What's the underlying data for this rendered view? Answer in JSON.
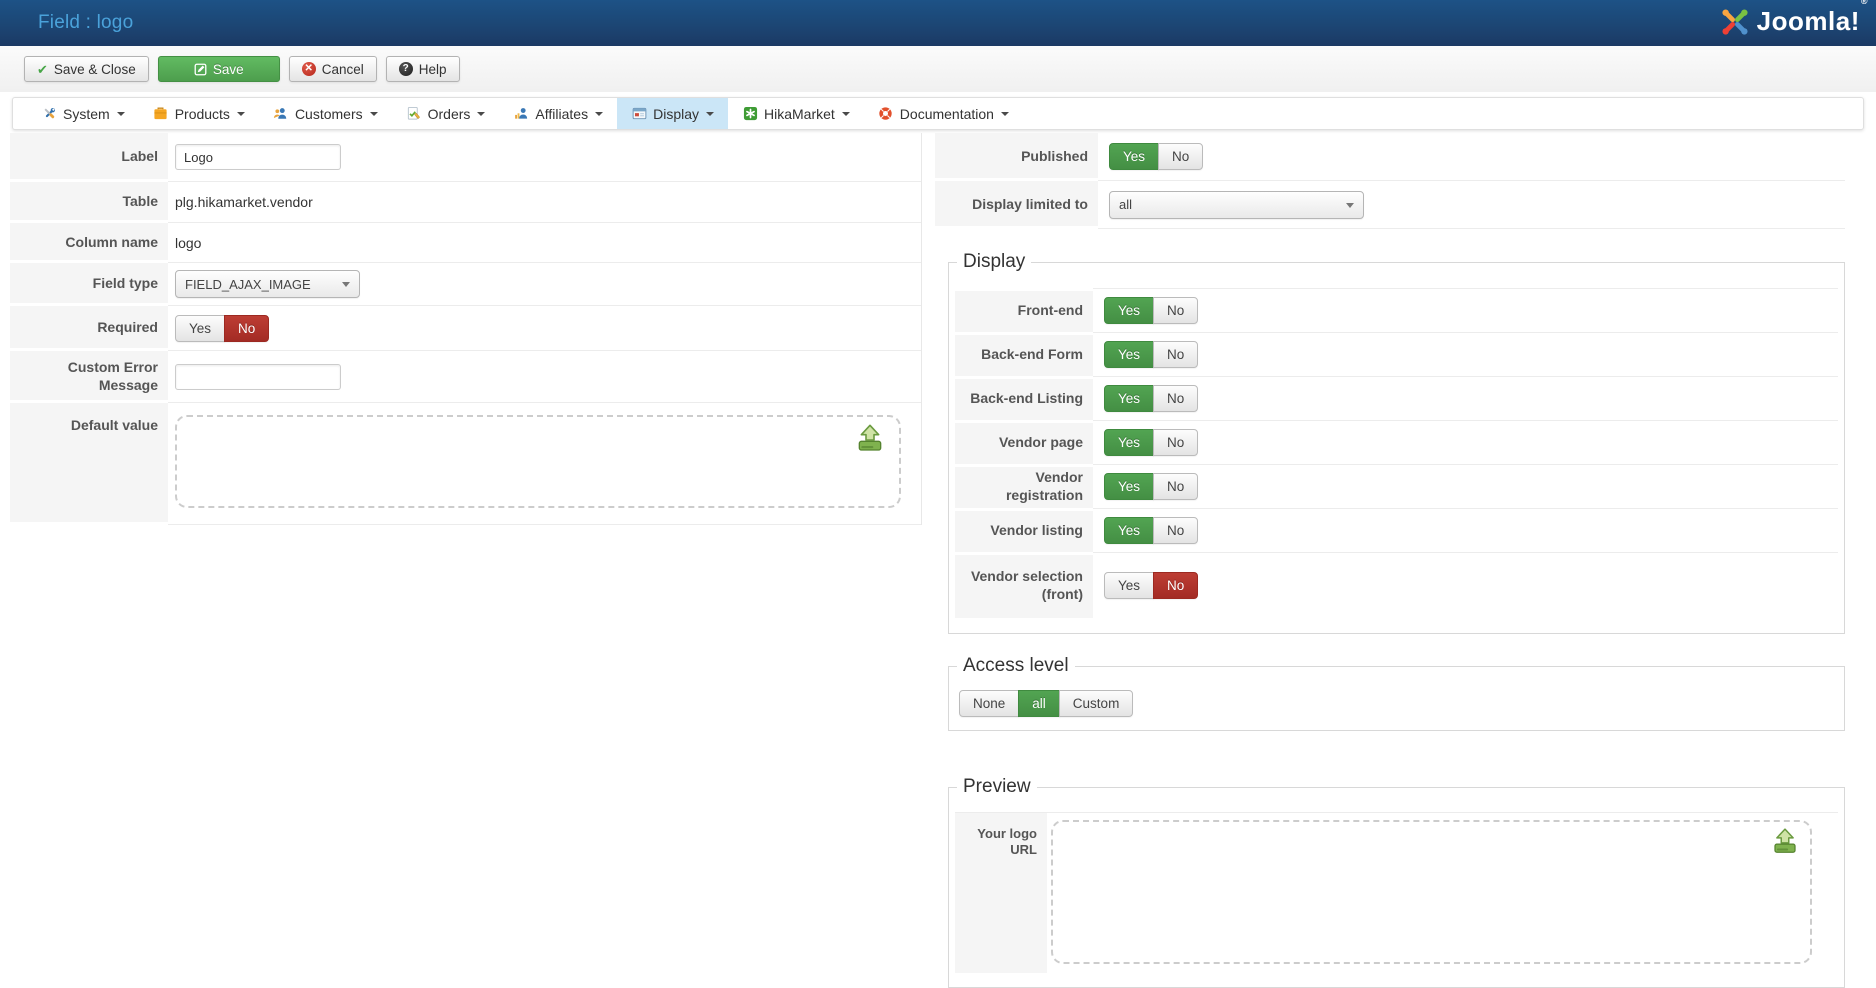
{
  "header": {
    "title": "Field : logo",
    "brand": "Joomla!",
    "brand_reg": "®"
  },
  "toolbar": {
    "save_close_label": "Save & Close",
    "save_label": "Save",
    "cancel_label": "Cancel",
    "help_label": "Help"
  },
  "menu": {
    "items": [
      {
        "label": "System",
        "icon": "tools-icon"
      },
      {
        "label": "Products",
        "icon": "box-icon"
      },
      {
        "label": "Customers",
        "icon": "users-icon"
      },
      {
        "label": "Orders",
        "icon": "order-icon"
      },
      {
        "label": "Affiliates",
        "icon": "affiliate-icon"
      },
      {
        "label": "Display",
        "icon": "display-icon",
        "active": true
      },
      {
        "label": "HikaMarket",
        "icon": "hikamarket-icon"
      },
      {
        "label": "Documentation",
        "icon": "documentation-icon"
      }
    ]
  },
  "toggle": {
    "yes": "Yes",
    "no": "No"
  },
  "form": {
    "label": {
      "label": "Label",
      "value": "Logo"
    },
    "table": {
      "label": "Table",
      "value": "plg.hikamarket.vendor"
    },
    "column_name": {
      "label": "Column name",
      "value": "logo"
    },
    "field_type": {
      "label": "Field type",
      "value": "FIELD_AJAX_IMAGE"
    },
    "required": {
      "label": "Required",
      "value": "no"
    },
    "custom_error": {
      "label": "Custom Error Message",
      "value": ""
    },
    "default_value": {
      "label": "Default value"
    }
  },
  "settings": {
    "published": {
      "label": "Published",
      "value": "yes"
    },
    "display_limited": {
      "label": "Display limited to",
      "value": "all"
    }
  },
  "display_section": {
    "legend": "Display",
    "rows": [
      {
        "label": "Front-end",
        "value": "yes"
      },
      {
        "label": "Back-end Form",
        "value": "yes"
      },
      {
        "label": "Back-end Listing",
        "value": "yes"
      },
      {
        "label": "Vendor page",
        "value": "yes"
      },
      {
        "label": "Vendor registration",
        "value": "yes"
      },
      {
        "label": "Vendor listing",
        "value": "yes"
      },
      {
        "label": "Vendor selection (front)",
        "value": "no"
      }
    ]
  },
  "access_section": {
    "legend": "Access level",
    "options": [
      "None",
      "all",
      "Custom"
    ],
    "selected": "all"
  },
  "preview_section": {
    "legend": "Preview",
    "row_label": "Your logo URL"
  },
  "colors": {
    "header_blue_top": "#1d5286",
    "header_blue_bottom": "#1b3964",
    "title_blue": "#4aa2da",
    "accent_green": "#46a546",
    "accent_red": "#b5302a",
    "menu_active_bg": "#cbe6f7"
  }
}
